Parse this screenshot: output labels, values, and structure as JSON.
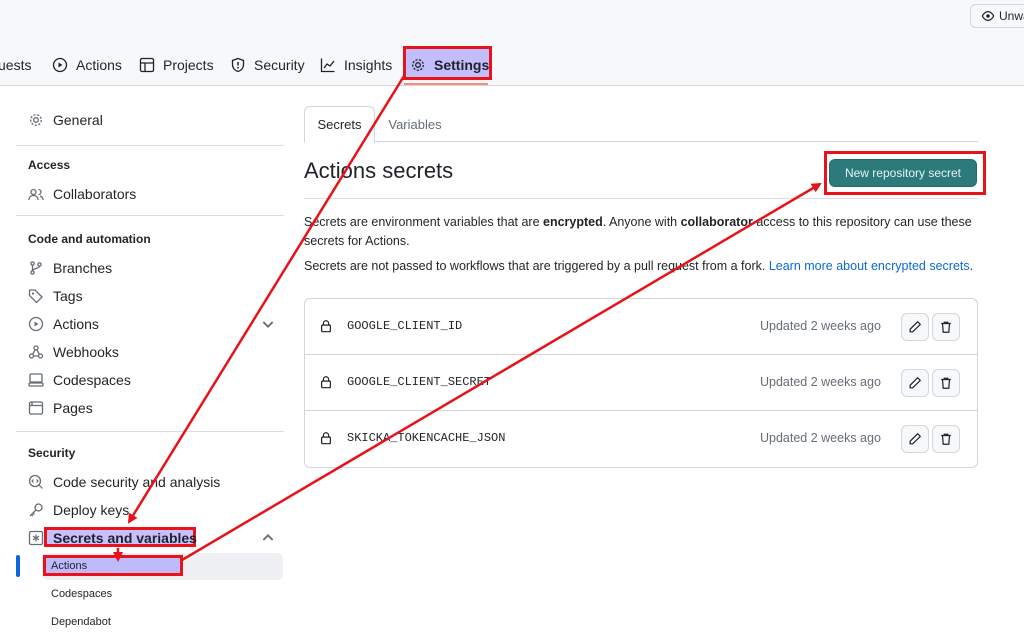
{
  "header": {
    "unwatch_label": "Unwa"
  },
  "repo_tabs": [
    {
      "label": "uests"
    },
    {
      "label": "Actions",
      "icon": "play-icon"
    },
    {
      "label": "Projects",
      "icon": "table-icon"
    },
    {
      "label": "Security",
      "icon": "shield-icon"
    },
    {
      "label": "Insights",
      "icon": "graph-icon"
    },
    {
      "label": "Settings",
      "icon": "gear-icon"
    }
  ],
  "sidebar": {
    "general": "General",
    "access_heading": "Access",
    "collaborators": "Collaborators",
    "code_heading": "Code and automation",
    "branches": "Branches",
    "tags": "Tags",
    "actions": "Actions",
    "webhooks": "Webhooks",
    "codespaces": "Codespaces",
    "pages": "Pages",
    "security_heading": "Security",
    "code_security": "Code security and analysis",
    "deploy_keys": "Deploy keys",
    "secrets_vars": "Secrets and variables",
    "sub": {
      "actions": "Actions",
      "codespaces": "Codespaces",
      "dependabot": "Dependabot"
    }
  },
  "main": {
    "tab_secrets": "Secrets",
    "tab_variables": "Variables",
    "title": "Actions secrets",
    "new_button": "New repository secret",
    "p1_a": "Secrets are environment variables that are ",
    "p1_b": "encrypted",
    "p1_c": ". Anyone with ",
    "p1_d": "collaborator",
    "p1_e": " access to this repository can use these secrets for Actions.",
    "p2": "Secrets are not passed to workflows that are triggered by a pull request from a fork. ",
    "p2_link": "Learn more about encrypted secrets",
    "p2_end": "."
  },
  "secrets": [
    {
      "name": "GOOGLE_CLIENT_ID",
      "updated": "Updated 2 weeks ago"
    },
    {
      "name": "GOOGLE_CLIENT_SECRET",
      "updated": "Updated 2 weeks ago"
    },
    {
      "name": "SKICKA_TOKENCACHE_JSON",
      "updated": "Updated 2 weeks ago"
    }
  ],
  "colors": {
    "annotation": "#e8131a",
    "highlight": "#a096ff",
    "accent": "#0969da",
    "button": "#2c7a7b"
  }
}
